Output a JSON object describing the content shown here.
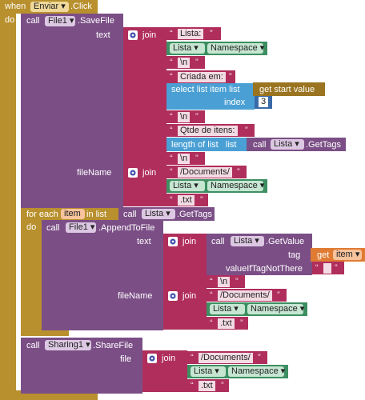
{
  "event": {
    "when": "when",
    "component": "Enviar",
    "event": ".Click",
    "do": "do"
  },
  "savefile": {
    "call": "call",
    "component": "File1",
    "method": ".SaveFile",
    "text_socket": "text",
    "filename_socket": "fileName"
  },
  "join_label": "join",
  "text_items": {
    "s1": "Lista:",
    "s2": "\\n",
    "s3": "Criada em:",
    "s4": "\\n",
    "s5": "Qtde de itens:",
    "s6": "\\n"
  },
  "namespace": {
    "component": "Lista",
    "prop": "Namespace"
  },
  "select_list": {
    "label": "select list item  list",
    "index_label": "index",
    "index_value": "3"
  },
  "get_start": "get start value",
  "length_list": {
    "label": "length of list",
    "list_label": "list"
  },
  "gettags": {
    "call": "call",
    "component": "Lista",
    "method": ".GetTags"
  },
  "file_parts": {
    "documents": "/Documents/",
    "txt": ".txt"
  },
  "foreach": {
    "label": "for each",
    "var": "item",
    "in_list": "in list",
    "do": "do"
  },
  "append": {
    "call": "call",
    "component": "File1",
    "method": ".AppendToFile",
    "text_socket": "text",
    "filename_socket": "fileName"
  },
  "getvalue": {
    "call": "call",
    "component": "Lista",
    "method": ".GetValue",
    "tag_socket": "tag",
    "default_socket": "valueIfTagNotThere"
  },
  "get_item": {
    "get": "get",
    "var": "item"
  },
  "append_newline": "\\n",
  "share": {
    "call": "call",
    "component": "Sharing1",
    "method": ".ShareFile",
    "file_socket": "file"
  }
}
